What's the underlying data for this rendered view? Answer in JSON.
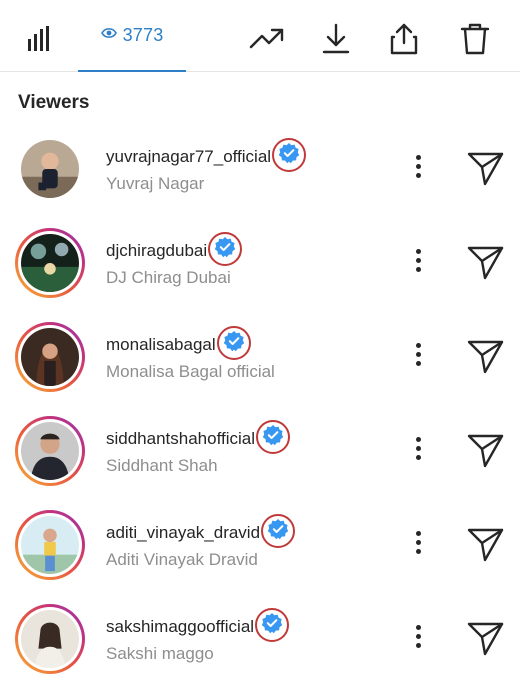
{
  "header": {
    "viewer_count": "3773",
    "icons": [
      "bar-chart-icon",
      "eye-icon",
      "trending-icon",
      "download-icon",
      "share-icon",
      "trash-icon"
    ]
  },
  "section_title": "Viewers",
  "colors": {
    "accent": "#2e7fc7",
    "verified": "#3897f0",
    "highlight_circle": "#c03a3a"
  },
  "viewers": [
    {
      "username": "yuvrajnagar77_official",
      "full_name": "Yuvraj Nagar",
      "verified": true,
      "story_ring": false
    },
    {
      "username": "djchiragdubai",
      "full_name": "DJ Chirag Dubai",
      "verified": true,
      "story_ring": true
    },
    {
      "username": "monalisabagal",
      "full_name": "Monalisa Bagal official",
      "verified": true,
      "story_ring": true
    },
    {
      "username": "siddhantshahofficial",
      "full_name": "Siddhant Shah",
      "verified": true,
      "story_ring": true
    },
    {
      "username": "aditi_vinayak_dravid",
      "full_name": "Aditi Vinayak Dravid",
      "verified": true,
      "story_ring": true
    },
    {
      "username": "sakshimaggoofficial",
      "full_name": "Sakshi maggo",
      "verified": true,
      "story_ring": true
    }
  ]
}
